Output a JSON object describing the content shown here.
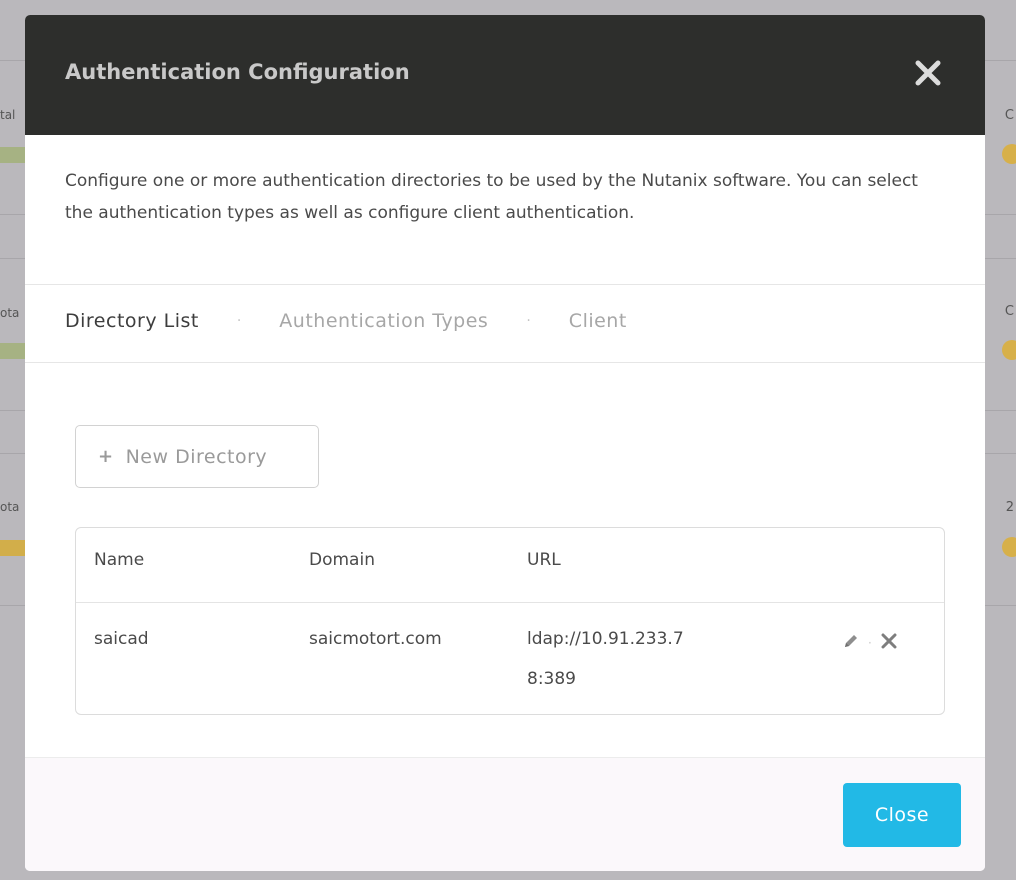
{
  "background": {
    "left_labels": [
      "tal",
      "ota",
      "ota"
    ],
    "right_labels": [
      "C",
      "C",
      "2"
    ]
  },
  "modal": {
    "title": "Authentication Configuration",
    "description": "Configure one or more authentication directories to be used by the Nutanix software. You can select the authentication types as well as configure client authentication.",
    "tabs": [
      {
        "label": "Directory List",
        "active": true
      },
      {
        "label": "Authentication Types",
        "active": false
      },
      {
        "label": "Client",
        "active": false
      }
    ],
    "tab_separator": "·",
    "new_directory_label": "New Directory",
    "new_directory_icon": "+",
    "table": {
      "headers": {
        "name": "Name",
        "domain": "Domain",
        "url": "URL"
      },
      "rows": [
        {
          "name": "saicad",
          "domain": "saicmotort.com",
          "url_line1": "ldap://10.91.233.7",
          "url_line2": "8:389"
        }
      ]
    },
    "close_label": "Close"
  },
  "colors": {
    "header_bg": "#2d2e2c",
    "accent": "#22b9e6"
  }
}
